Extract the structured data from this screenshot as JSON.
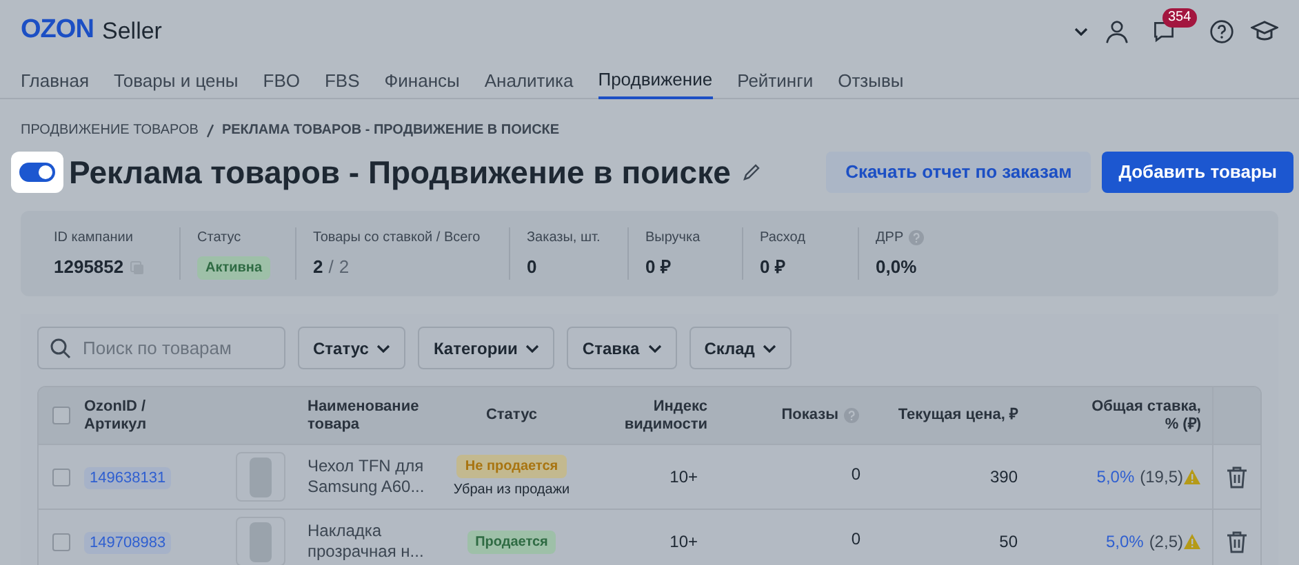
{
  "header": {
    "logo": "OZON",
    "logo_suffix": "Seller",
    "notifications_badge": "354"
  },
  "nav": [
    {
      "label": "Главная",
      "selected": false
    },
    {
      "label": "Товары и цены",
      "selected": false
    },
    {
      "label": "FBO",
      "selected": false
    },
    {
      "label": "FBS",
      "selected": false
    },
    {
      "label": "Финансы",
      "selected": false
    },
    {
      "label": "Аналитика",
      "selected": false
    },
    {
      "label": "Продвижение",
      "selected": true
    },
    {
      "label": "Рейтинги",
      "selected": false
    },
    {
      "label": "Отзывы",
      "selected": false
    }
  ],
  "breadcrumbs": [
    "ПРОДВИЖЕНИЕ ТОВАРОВ",
    "РЕКЛАМА ТОВАРОВ - ПРОДВИЖЕНИЕ В ПОИСКЕ"
  ],
  "campaign": {
    "on": true,
    "title": "Реклама товаров - Продвижение в поиске"
  },
  "actions": [
    "Скачать отчет по заказам",
    "Добавить товары"
  ],
  "stats": [
    {
      "label": "ID кампании",
      "kind": "id",
      "value": "1295852"
    },
    {
      "label": "Статус",
      "kind": "badge",
      "value": "Активна"
    },
    {
      "label": "Товары со ставкой / Всего",
      "kind": "ratio",
      "value": "2",
      "separator": "/",
      "total": "2"
    },
    {
      "label": "Заказы, шт.",
      "kind": "plain",
      "value": "0"
    },
    {
      "label": "Выручка",
      "kind": "plain",
      "value": "0 ₽"
    },
    {
      "label": "Расход",
      "kind": "plain",
      "value": "0 ₽"
    },
    {
      "label": "ДРР",
      "kind": "help",
      "value": "0,0%"
    }
  ],
  "search": {
    "placeholder": "Поиск по товарам"
  },
  "filters": [
    "Статус",
    "Категории",
    "Ставка",
    "Склад"
  ],
  "table": {
    "all_checked": false,
    "columns": [
      "OzonID / Артикул",
      "Наименование товара",
      "Статус",
      "Индекс видимости",
      "Показы",
      "Текущая цена, ₽",
      "Общая ставка, % (₽)"
    ],
    "rows": [
      {
        "checked": false,
        "id": "149638131",
        "name": "Чехол TFN для Samsung A60...",
        "status": "Не продается",
        "kind": "not_selling",
        "status_note": "Убран из продажи",
        "visibility": "10+",
        "shows": "0",
        "price": "390",
        "rate": "5,0%",
        "rate_rub": "(19,5)"
      },
      {
        "checked": false,
        "id": "149708983",
        "name": "Накладка прозрачная н...",
        "status": "Продается",
        "kind": "selling",
        "visibility": "10+",
        "shows": "0",
        "price": "50",
        "rate": "5,0%",
        "rate_rub": "(2,5)"
      }
    ]
  }
}
